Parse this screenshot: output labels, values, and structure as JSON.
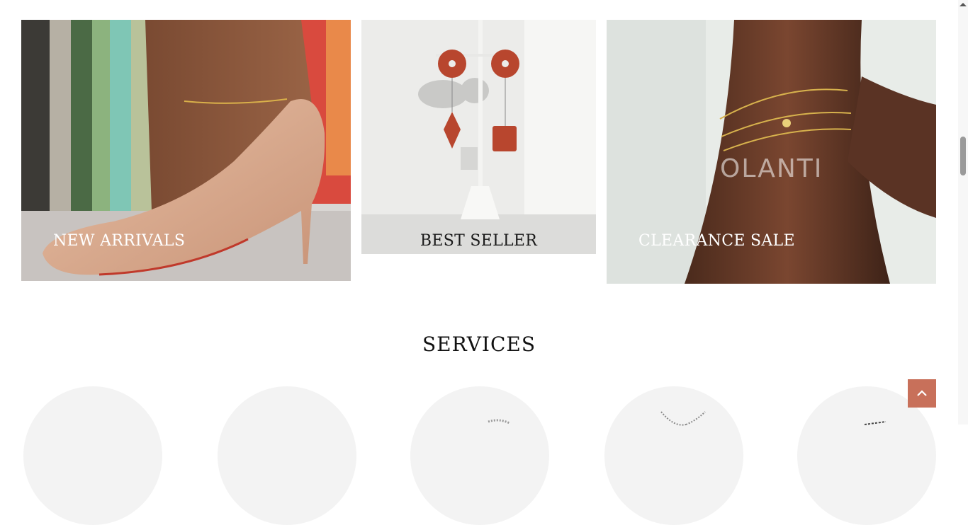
{
  "promos": [
    {
      "label": "NEW ARRIVALS"
    },
    {
      "label": "BEST SELLER"
    },
    {
      "label": "CLEARANCE SALE"
    }
  ],
  "services": {
    "title": "SERVICES"
  },
  "brand_watermark": "OLANTI",
  "colors": {
    "accent": "#c8705a",
    "service_bg": "#f3f3f3"
  },
  "icons": {
    "scroll_top": "chevron-up-icon"
  }
}
